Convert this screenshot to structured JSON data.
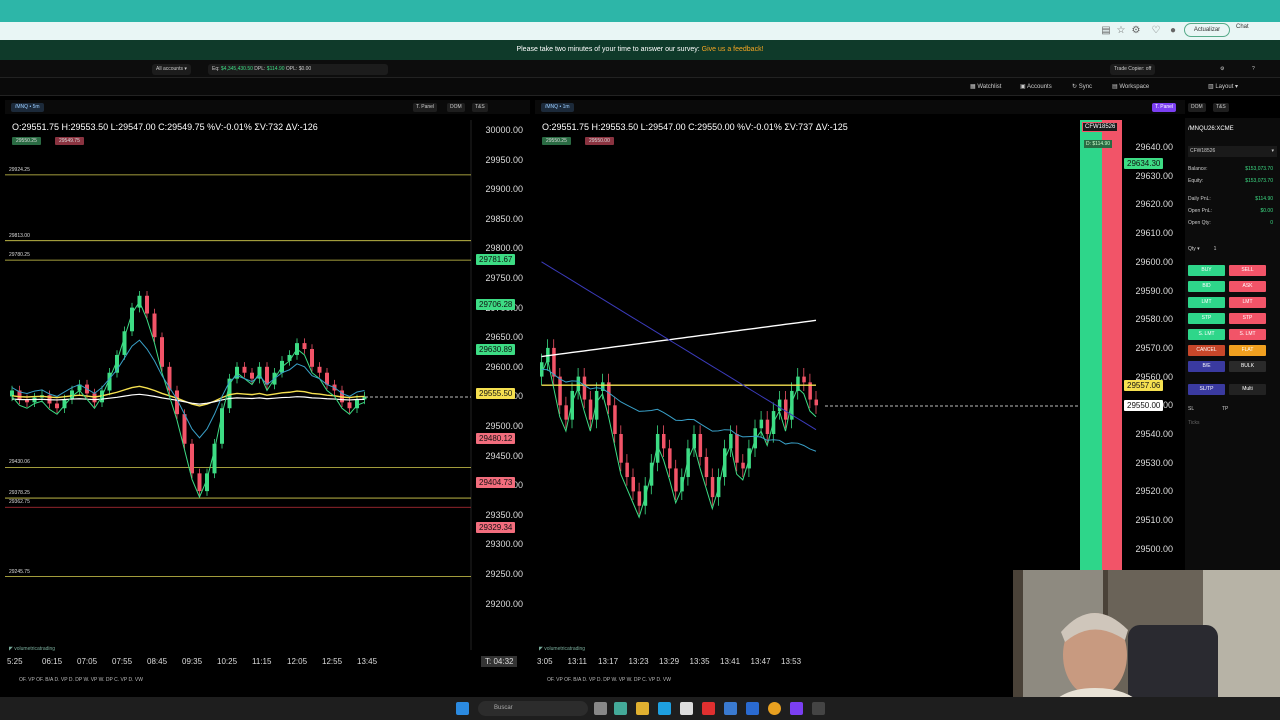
{
  "browser": {
    "update_label": "Actualizar",
    "chat_label": "Chat"
  },
  "survey": {
    "text": "Please take two minutes of your time to answer our survey:",
    "link": "Give us a feedback!"
  },
  "toolbar1": {
    "accounts": "All accounts",
    "eq_label": "Eq:",
    "eq": "$4,345,430.50",
    "dpl_label": "DPL:",
    "dpl": "$114.90",
    "opl_label": "OPL:",
    "opl": "$0.00",
    "trade_copier": "Trade Copier: off"
  },
  "toolbar2": {
    "watchlist": "Watchlist",
    "accounts": "Accounts",
    "sync": "Sync",
    "workspace": "Workspace",
    "layout": "Layout"
  },
  "left_chart": {
    "symbol": "/MNQ",
    "tf": "5m",
    "buttons": [
      "T. Panel",
      "DOM",
      "T&S"
    ],
    "ohlc": "O:29551.75  H:29553.50  L:29547.00  C:29549.75  %V:-0.01%  ΣV:732  ΔV:-126",
    "bid": "29550.25",
    "ask": "29549.75",
    "yaxis": [
      "30000.00",
      "29950.00",
      "29900.00",
      "29850.00",
      "29800.00",
      "29750.00",
      "29700.00",
      "29650.00",
      "29600.00",
      "29550.00",
      "29500.00",
      "29450.00",
      "29400.00",
      "29350.00",
      "29300.00",
      "29250.00",
      "29200.00"
    ],
    "levels": [
      "29924.25",
      "29813.00",
      "29780.25",
      "29430.06",
      "29378.25",
      "29362.75",
      "29245.75"
    ],
    "tags": [
      {
        "t": "29781.67",
        "c": "#3ddc84"
      },
      {
        "t": "29706.28",
        "c": "#3ddc84"
      },
      {
        "t": "29630.89",
        "c": "#3ddc84"
      },
      {
        "t": "29555.50",
        "c": "#f5e050"
      },
      {
        "t": "29480.12",
        "c": "#f26d7d"
      },
      {
        "t": "29404.73",
        "c": "#f26d7d"
      },
      {
        "t": "29329.34",
        "c": "#f26d7d"
      }
    ],
    "xaxis": [
      "5:25",
      "06:15",
      "07:05",
      "07:55",
      "08:45",
      "09:35",
      "10:25",
      "11:15",
      "12:05",
      "12:55",
      "13:45"
    ],
    "timer": "T: 04:32",
    "bottom": "OF. VP     OF. B/A     D. VP     D. DP     W. VP     W. DP     C. VP     D. VW"
  },
  "right_chart": {
    "symbol": "/MNQ",
    "tf": "1m",
    "buttons": [
      "T. Panel",
      "DOM",
      "T&S"
    ],
    "ohlc": "O:29551.75  H:29553.50  L:29547.00  C:29550.00  %V:-0.01%  ΣV:737  ΔV:-125",
    "bid": "29550.25",
    "ask": "29550.00",
    "yaxis": [
      "29640.00",
      "29630.00",
      "29620.00",
      "29610.00",
      "29600.00",
      "29590.00",
      "29580.00",
      "29570.00",
      "29560.00",
      "29550.00",
      "29540.00",
      "29530.00",
      "29520.00",
      "29510.00",
      "29500.00"
    ],
    "tags": [
      {
        "t": "29634.30",
        "c": "#3ddc84"
      },
      {
        "t": "29557.06",
        "c": "#f5e050"
      },
      {
        "t": "29550.00",
        "c": "#ffffff"
      }
    ],
    "xaxis": [
      "3:05",
      "13:11",
      "13:17",
      "13:23",
      "13:29",
      "13:35",
      "13:41",
      "13:47",
      "13:53"
    ],
    "account_tag": "CFW18526",
    "pnl_tag": "D: $114.90",
    "bottom": "OF. VP     OF. B/A     D. VP     D. DP     W. VP     W. DP     C. VP     D. VW"
  },
  "sidebar": {
    "symbol": "/MNQU26:XCME",
    "account": "CFW18526",
    "rows": [
      {
        "k": "Balance:",
        "v": "$153,073.70"
      },
      {
        "k": "Equity:",
        "v": "$153,073.70"
      },
      {
        "k": "Daily PnL:",
        "v": "$114.90"
      },
      {
        "k": "Open PnL:",
        "v": "$0.00"
      },
      {
        "k": "Open Qty:",
        "v": "0"
      }
    ],
    "qty_label": "Qty",
    "qty": "1",
    "buttons": [
      [
        "BUY",
        "SELL"
      ],
      [
        "BID",
        "ASK"
      ],
      [
        "LMT",
        "LMT"
      ],
      [
        "STP",
        "STP"
      ],
      [
        "S. LMT",
        "S. LMT"
      ],
      [
        "CANCEL",
        "FLAT"
      ],
      [
        "B/E",
        "BULK"
      ]
    ],
    "sltp": "SL/TP",
    "multi": "Multi",
    "sl": "SL",
    "tp": "TP",
    "ticks": "Ticks"
  },
  "taskbar": {
    "search": "Buscar"
  }
}
